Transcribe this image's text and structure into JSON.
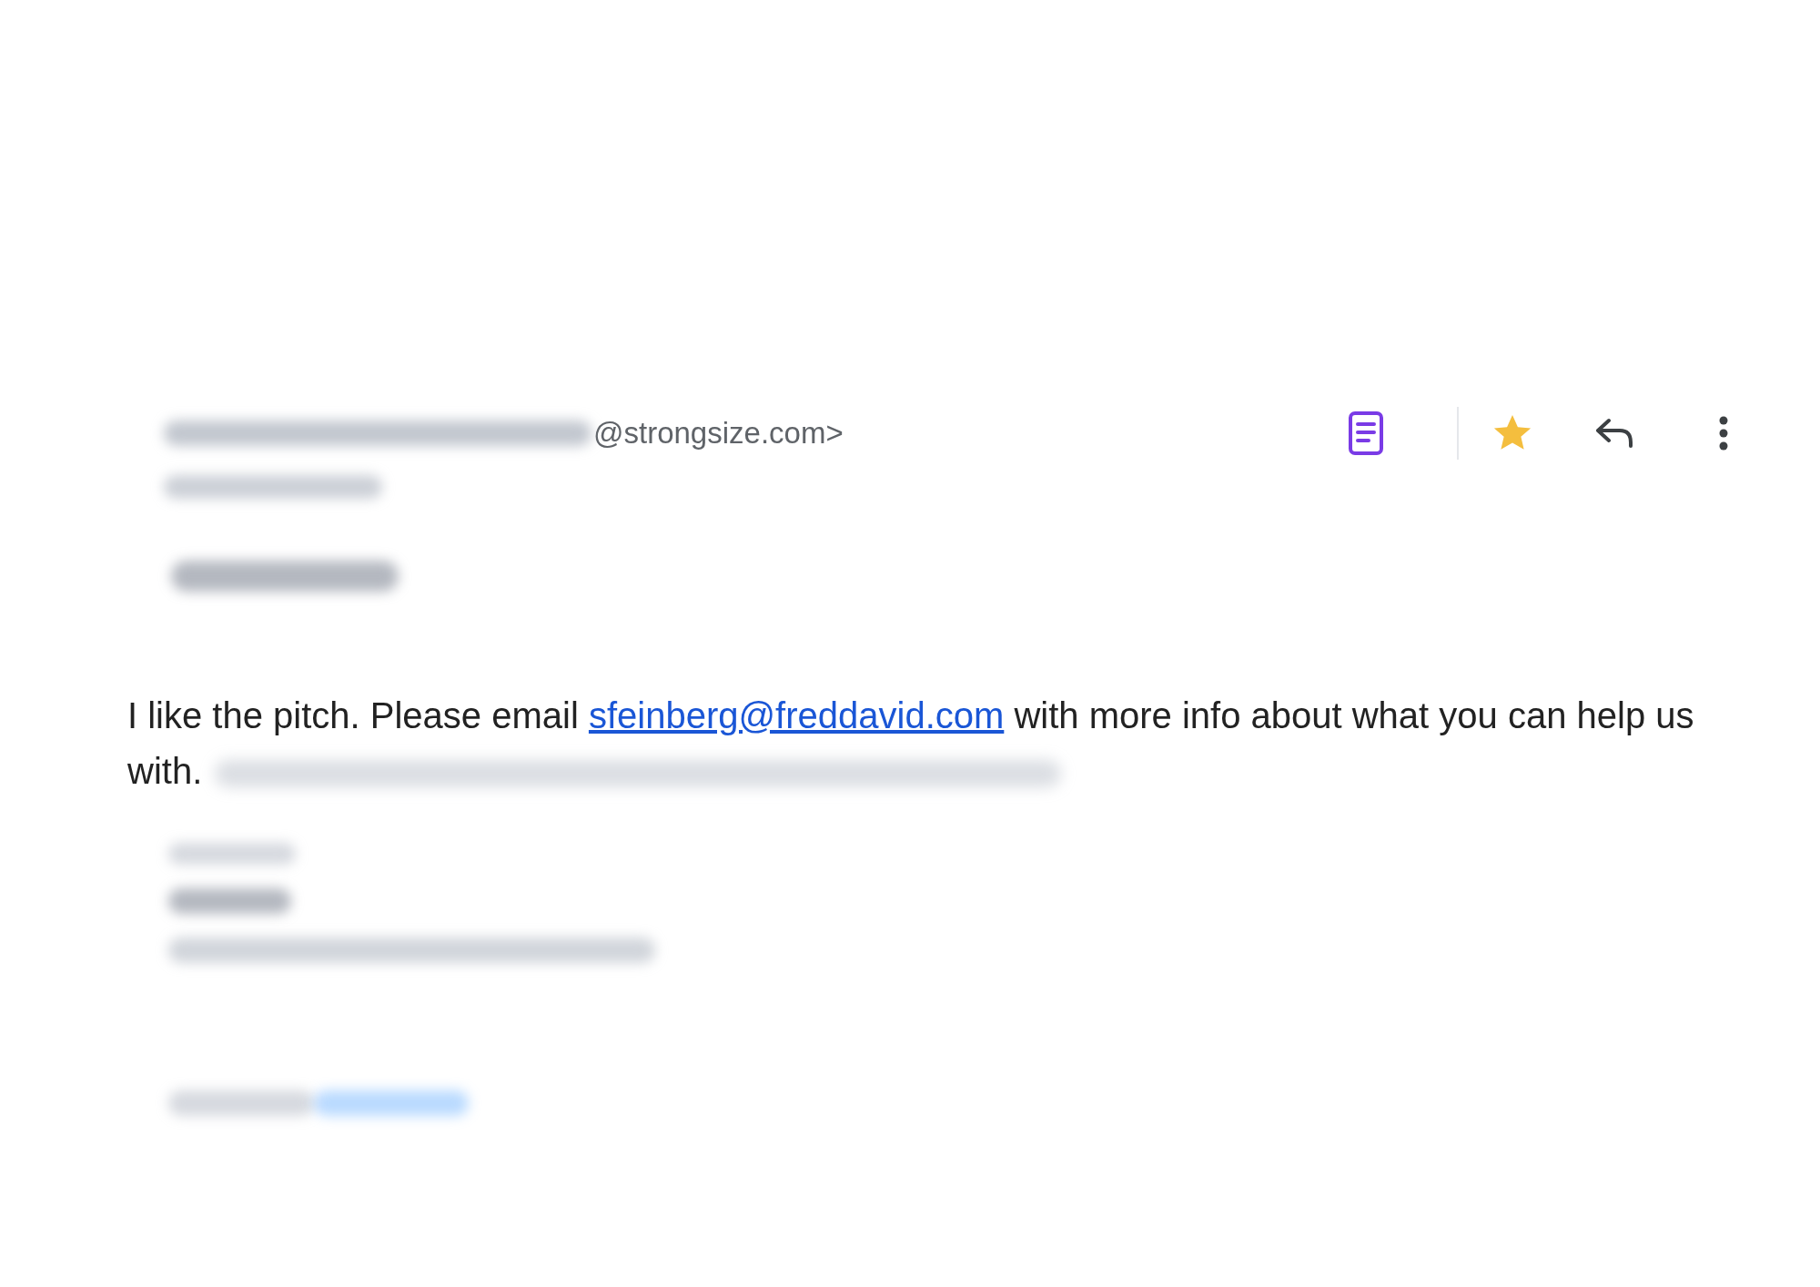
{
  "message_header": {
    "sender_visible": "@strongsize.com>",
    "starred": true
  },
  "body": {
    "text_before": "I like the pitch. Please email ",
    "link": "sfeinberg@freddavid.com",
    "text_after": " with more info about what you can help us with."
  }
}
